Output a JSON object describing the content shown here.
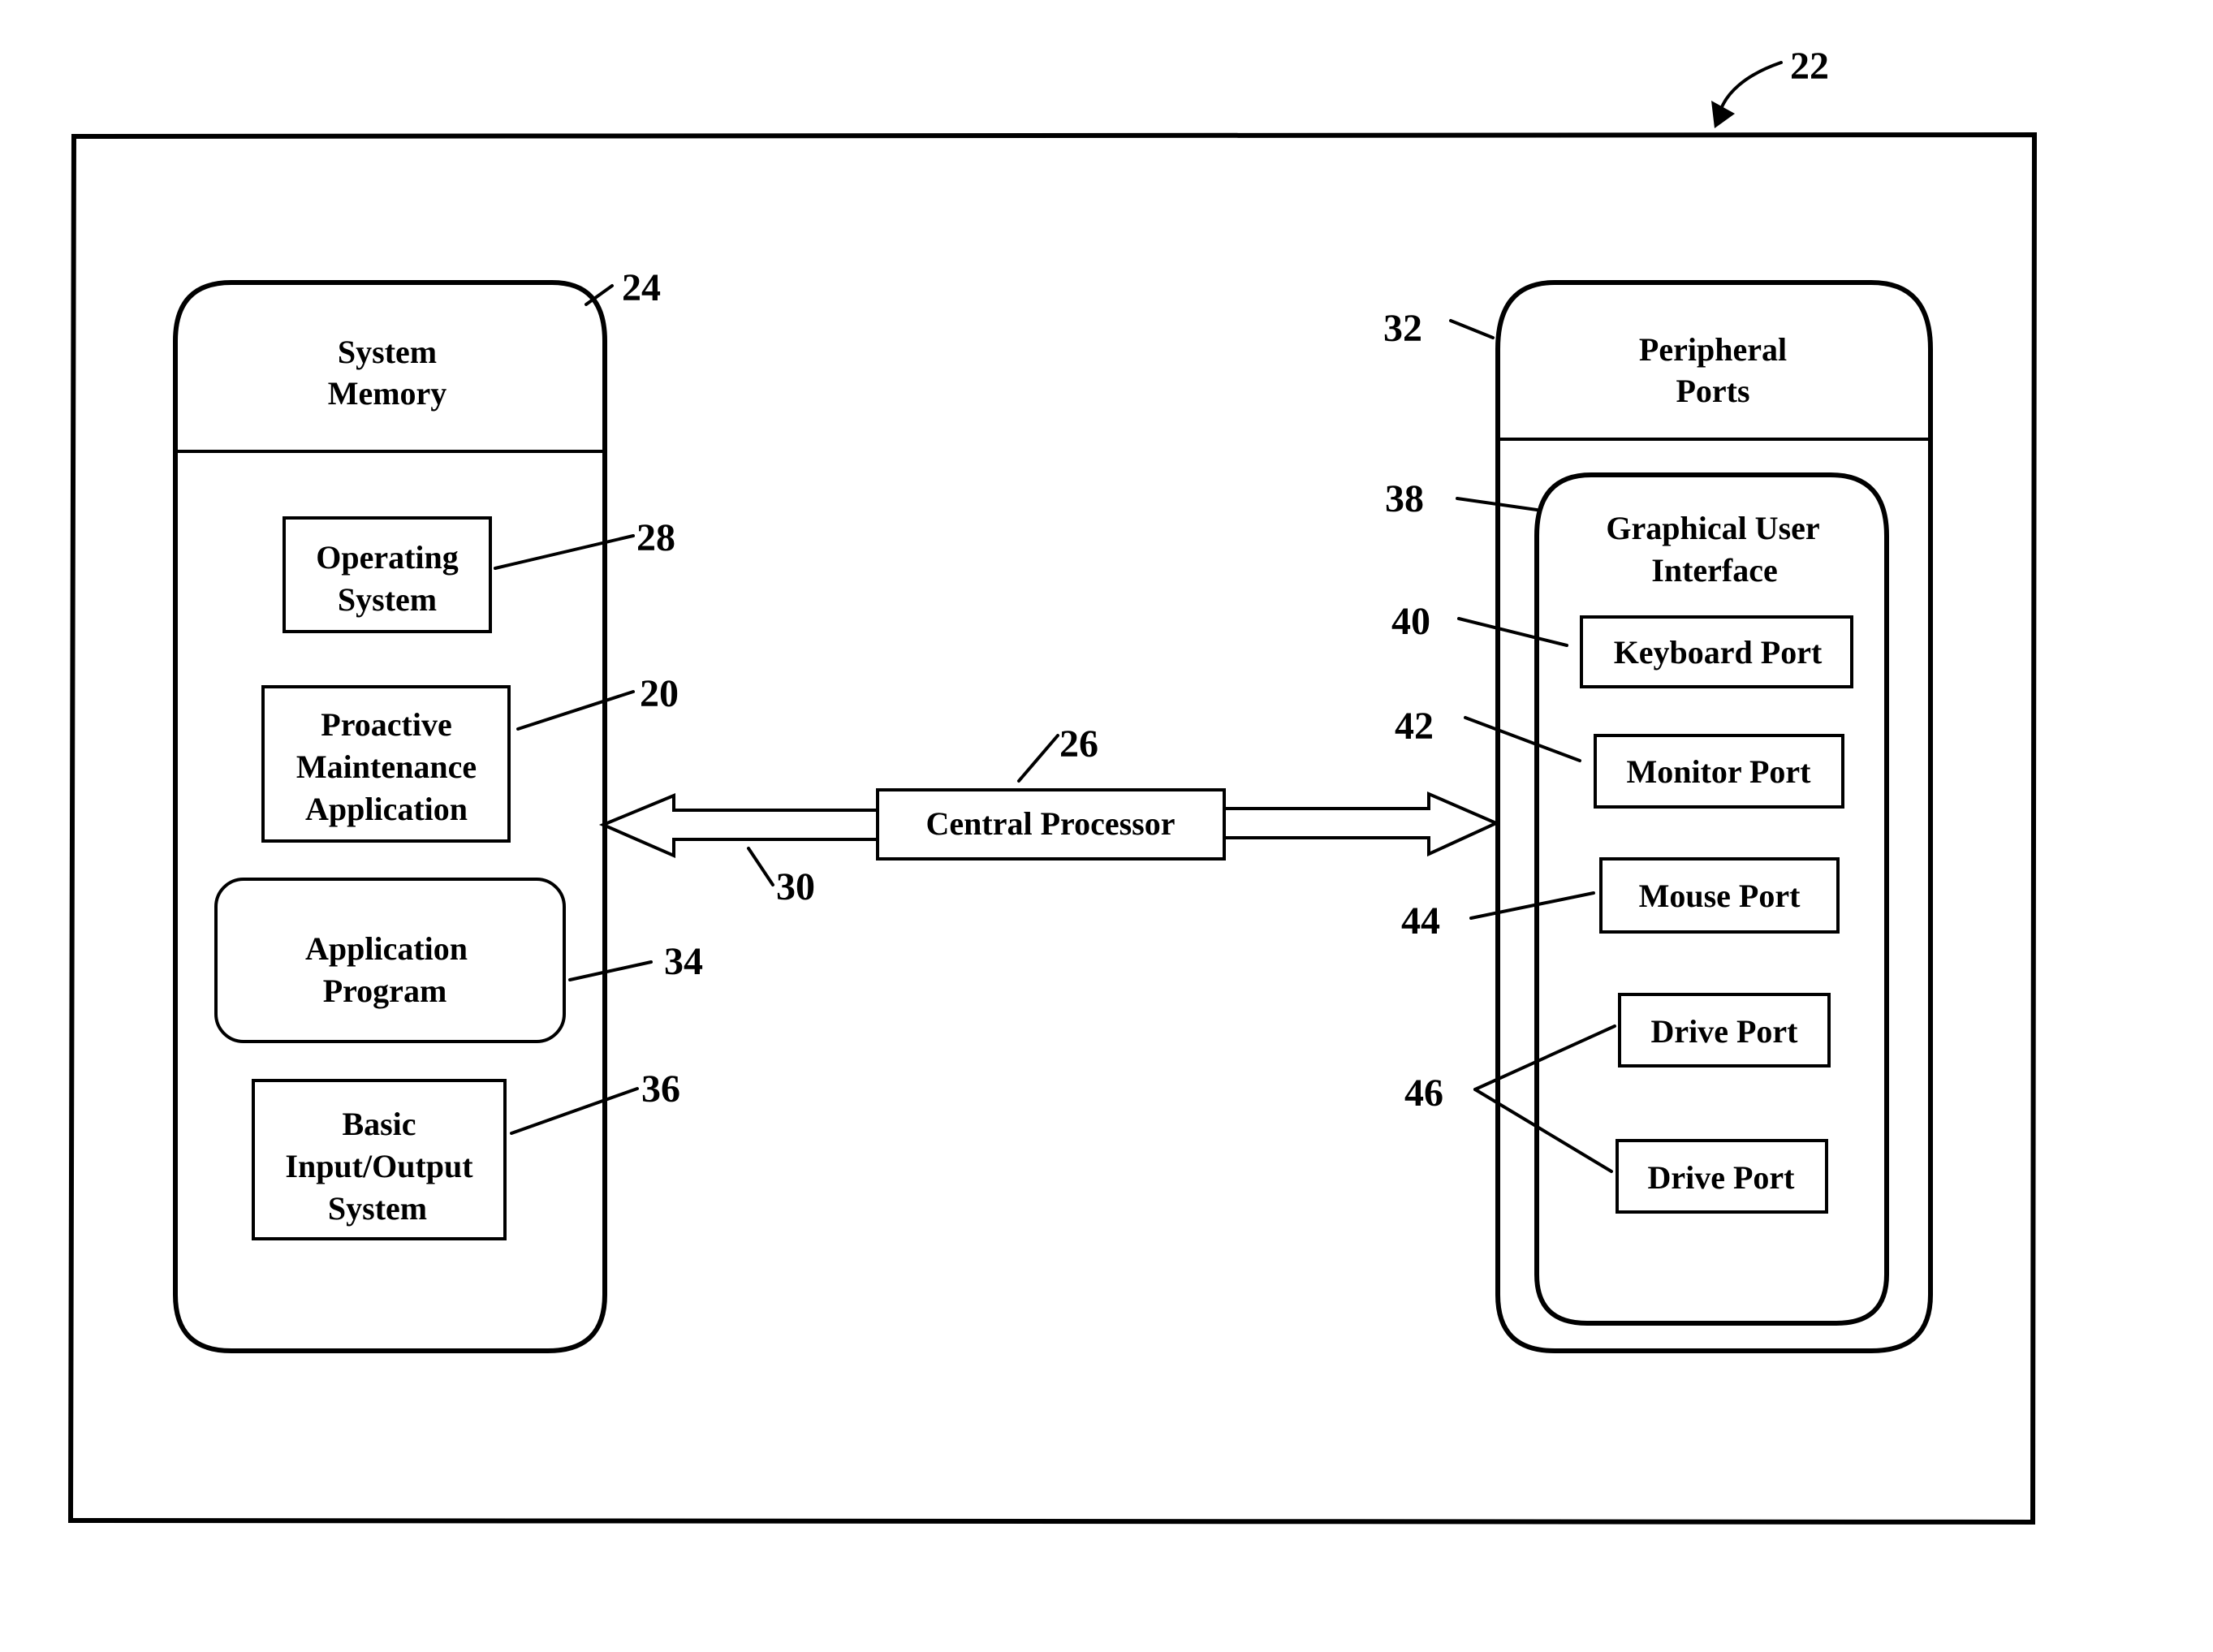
{
  "figure": {
    "reference_number": "22",
    "system_memory": {
      "reference_number": "24",
      "title_lines": [
        "System",
        "Memory"
      ],
      "items": [
        {
          "reference_number": "28",
          "lines": [
            "Operating",
            "System"
          ]
        },
        {
          "reference_number": "20",
          "lines": [
            "Proactive",
            "Maintenance",
            "Application"
          ]
        },
        {
          "reference_number": "34",
          "lines": [
            "Application",
            "Program"
          ]
        },
        {
          "reference_number": "36",
          "lines": [
            "Basic",
            "Input/Output",
            "System"
          ]
        }
      ]
    },
    "central_processor": {
      "reference_number": "26",
      "label": "Central Processor"
    },
    "bus": {
      "reference_number": "30"
    },
    "peripheral_ports": {
      "reference_number": "32",
      "title_lines": [
        "Peripheral",
        "Ports"
      ],
      "gui": {
        "reference_number": "38",
        "title_lines": [
          "Graphical User",
          "Interface"
        ],
        "ports": [
          {
            "reference_number": "40",
            "label": "Keyboard Port"
          },
          {
            "reference_number": "42",
            "label": "Monitor Port"
          },
          {
            "reference_number": "44",
            "label": "Mouse Port"
          },
          {
            "reference_number": "46",
            "label": "Drive Port"
          },
          {
            "reference_number": "46",
            "label": "Drive Port"
          }
        ],
        "drive_ports_reference_number": "46"
      }
    }
  }
}
